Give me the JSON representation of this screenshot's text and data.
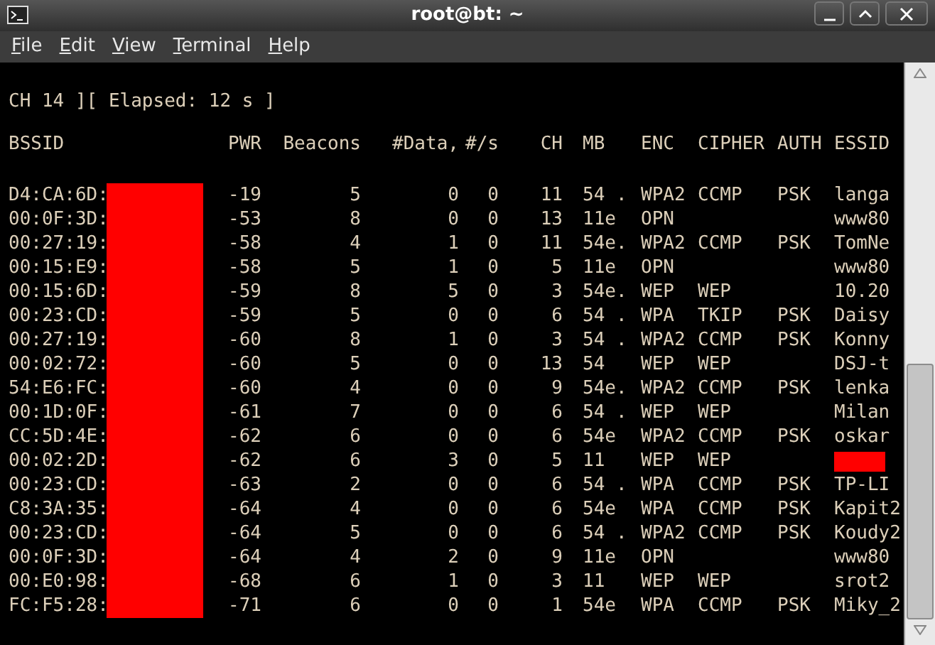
{
  "window": {
    "title": "root@bt: ~"
  },
  "menu": [
    "File",
    "Edit",
    "View",
    "Terminal",
    "Help"
  ],
  "status_line": "CH 14 ][ Elapsed: 12 s ]",
  "table": {
    "columns": [
      "BSSID",
      "PWR",
      "Beacons",
      "#Data,",
      "#/s",
      "CH",
      "MB",
      "ENC",
      "CIPHER",
      "AUTH",
      "ESSID"
    ],
    "rows": [
      {
        "bssid": "D4:CA:6D:",
        "pwr": "-19",
        "beacons": "5",
        "data": "0",
        "rate": "0",
        "ch": "11",
        "mb": "54 .",
        "enc": "WPA2",
        "cipher": "CCMP",
        "auth": "PSK",
        "essid": "langa",
        "essid_redacted": false
      },
      {
        "bssid": "00:0F:3D:",
        "pwr": "-53",
        "beacons": "8",
        "data": "0",
        "rate": "0",
        "ch": "13",
        "mb": "11e",
        "enc": "OPN",
        "essid": "www80",
        "essid_redacted": false
      },
      {
        "bssid": "00:27:19:",
        "pwr": "-58",
        "beacons": "4",
        "data": "1",
        "rate": "0",
        "ch": "11",
        "mb": "54e.",
        "enc": "WPA2",
        "cipher": "CCMP",
        "auth": "PSK",
        "essid": "TomNe",
        "essid_redacted": false
      },
      {
        "bssid": "00:15:E9:",
        "pwr": "-58",
        "beacons": "5",
        "data": "1",
        "rate": "0",
        "ch": "5",
        "mb": "11e",
        "enc": "OPN",
        "essid": "www80",
        "essid_redacted": false
      },
      {
        "bssid": "00:15:6D:",
        "pwr": "-59",
        "beacons": "8",
        "data": "5",
        "rate": "0",
        "ch": "3",
        "mb": "54e.",
        "enc": "WEP",
        "cipher": "WEP",
        "essid": "10.20",
        "essid_redacted": false
      },
      {
        "bssid": "00:23:CD:",
        "pwr": "-59",
        "beacons": "5",
        "data": "0",
        "rate": "0",
        "ch": "6",
        "mb": "54 .",
        "enc": "WPA",
        "cipher": "TKIP",
        "auth": "PSK",
        "essid": "Daisy",
        "essid_redacted": false
      },
      {
        "bssid": "00:27:19:",
        "pwr": "-60",
        "beacons": "8",
        "data": "1",
        "rate": "0",
        "ch": "3",
        "mb": "54 .",
        "enc": "WPA2",
        "cipher": "CCMP",
        "auth": "PSK",
        "essid": "Konny",
        "essid_redacted": false
      },
      {
        "bssid": "00:02:72:",
        "pwr": "-60",
        "beacons": "5",
        "data": "0",
        "rate": "0",
        "ch": "13",
        "mb": "54",
        "enc": "WEP",
        "cipher": "WEP",
        "essid": "DSJ-t",
        "essid_redacted": false
      },
      {
        "bssid": "54:E6:FC:",
        "pwr": "-60",
        "beacons": "4",
        "data": "0",
        "rate": "0",
        "ch": "9",
        "mb": "54e.",
        "enc": "WPA2",
        "cipher": "CCMP",
        "auth": "PSK",
        "essid": "lenka",
        "essid_redacted": false
      },
      {
        "bssid": "00:1D:0F:",
        "pwr": "-61",
        "beacons": "7",
        "data": "0",
        "rate": "0",
        "ch": "6",
        "mb": "54 .",
        "enc": "WEP",
        "cipher": "WEP",
        "essid": "Milan",
        "essid_redacted": false
      },
      {
        "bssid": "CC:5D:4E:",
        "pwr": "-62",
        "beacons": "6",
        "data": "0",
        "rate": "0",
        "ch": "6",
        "mb": "54e",
        "enc": "WPA2",
        "cipher": "CCMP",
        "auth": "PSK",
        "essid": "oskar",
        "essid_redacted": false
      },
      {
        "bssid": "00:02:2D:",
        "pwr": "-62",
        "beacons": "6",
        "data": "3",
        "rate": "0",
        "ch": "5",
        "mb": "11",
        "enc": "WEP",
        "cipher": "WEP",
        "essid_redacted": true
      },
      {
        "bssid": "00:23:CD:",
        "pwr": "-63",
        "beacons": "2",
        "data": "0",
        "rate": "0",
        "ch": "6",
        "mb": "54 .",
        "enc": "WPA",
        "cipher": "CCMP",
        "auth": "PSK",
        "essid": "TP-LI",
        "essid_redacted": false
      },
      {
        "bssid": "C8:3A:35:",
        "pwr": "-64",
        "beacons": "4",
        "data": "0",
        "rate": "0",
        "ch": "6",
        "mb": "54e",
        "enc": "WPA",
        "cipher": "CCMP",
        "auth": "PSK",
        "essid": "Kapit2",
        "essid_redacted": false
      },
      {
        "bssid": "00:23:CD:",
        "pwr": "-64",
        "beacons": "5",
        "data": "0",
        "rate": "0",
        "ch": "6",
        "mb": "54 .",
        "enc": "WPA2",
        "cipher": "CCMP",
        "auth": "PSK",
        "essid": "Koudy2",
        "essid_redacted": false
      },
      {
        "bssid": "00:0F:3D:",
        "pwr": "-64",
        "beacons": "4",
        "data": "2",
        "rate": "0",
        "ch": "9",
        "mb": "11e",
        "enc": "OPN",
        "essid": "www80",
        "essid_redacted": false
      },
      {
        "bssid": "00:E0:98:",
        "pwr": "-68",
        "beacons": "6",
        "data": "1",
        "rate": "0",
        "ch": "3",
        "mb": "11",
        "enc": "WEP",
        "cipher": "WEP",
        "essid": "srot2",
        "essid_redacted": false
      },
      {
        "bssid": "FC:F5:28:",
        "pwr": "-71",
        "beacons": "6",
        "data": "0",
        "rate": "0",
        "ch": "1",
        "mb": "54e",
        "enc": "WPA",
        "cipher": "CCMP",
        "auth": "PSK",
        "essid": "Miky_2",
        "essid_redacted": false
      }
    ]
  }
}
